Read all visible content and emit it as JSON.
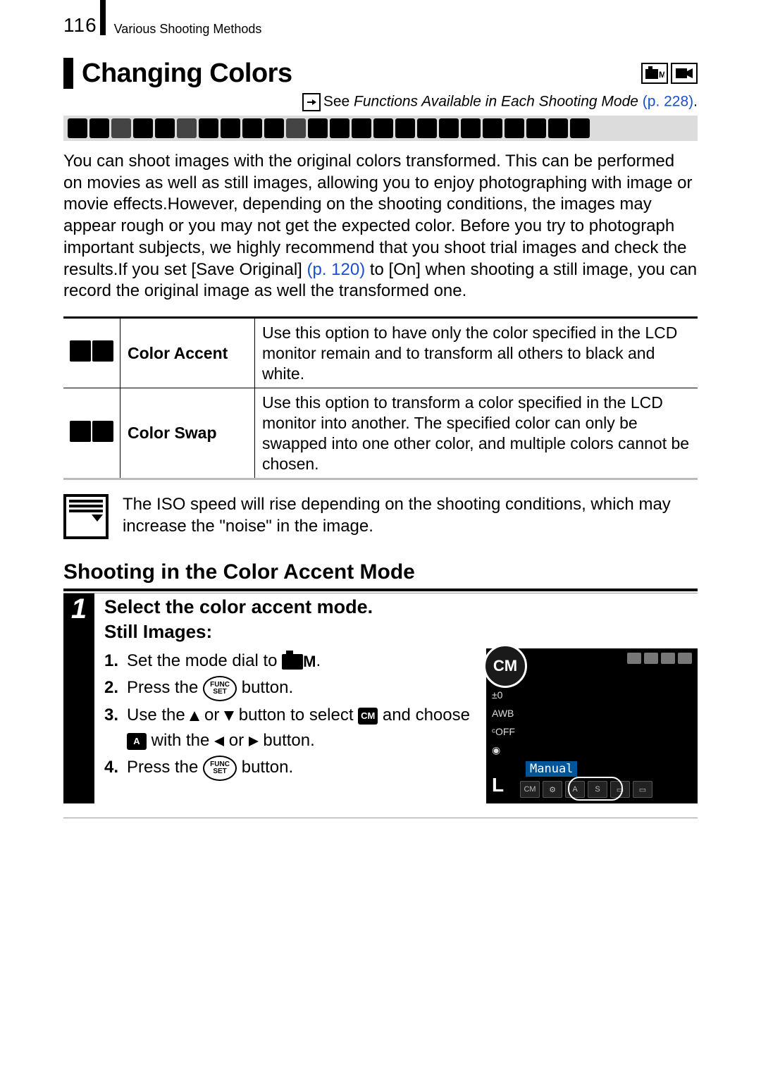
{
  "header": {
    "page_number": "116",
    "section": "Various Shooting Methods"
  },
  "title": "Changing Colors",
  "see_line": {
    "prefix": "See ",
    "text": "Functions Available in Each Shooting Mode ",
    "page_ref": "(p. 228)",
    "dot": "."
  },
  "intro": {
    "part1": "You can shoot images with the original colors transformed. This can be performed on movies as well as still images, allowing you to enjoy photographing with image or movie effects.However, depending on the shooting conditions, the images may appear rough or you may not get the expected color. Before you try to photograph important subjects, we highly recommend that you shoot trial images and check the results.If you set [Save Original] ",
    "page_ref": "(p. 120)",
    "part2": " to [On] when shooting a still image, you can record the original image as well the transformed one."
  },
  "table": {
    "rows": [
      {
        "label": "Color Accent",
        "desc": "Use this option to have only the color specified in the LCD monitor remain and to transform all others to black and white."
      },
      {
        "label": "Color Swap",
        "desc": "Use this option to transform a color specified in the LCD monitor into another. The specified color can only be swapped into one other color, and multiple colors cannot be chosen."
      }
    ]
  },
  "note": "The ISO speed will rise depending on the shooting conditions, which may increase the \"noise\" in the image.",
  "subhead": "Shooting in the Color Accent Mode",
  "step": {
    "num": "1",
    "title": "Select the color accent mode.",
    "sub": "Still Images:",
    "instructions": [
      {
        "n": "1.",
        "pre": "Set the mode dial to ",
        "post": "."
      },
      {
        "n": "2.",
        "pre": "Press the ",
        "post": " button."
      },
      {
        "n": "3.",
        "t3a": "Use the ",
        "t3b": " or ",
        "t3c": " button to select ",
        "t3d": " and choose ",
        "t3e": " with the ",
        "t3f": " or ",
        "t3g": " button."
      },
      {
        "n": "4.",
        "pre": "Press the ",
        "post": " button."
      }
    ]
  },
  "lcd": {
    "dial": "CM",
    "label": "Manual",
    "bottom_l": "L",
    "bottom_modes": [
      "CM",
      "⚙",
      "A",
      "S",
      "▭",
      "▭"
    ],
    "left_col": [
      "±0",
      "AWB",
      "ᶜOFF",
      "◉"
    ]
  }
}
